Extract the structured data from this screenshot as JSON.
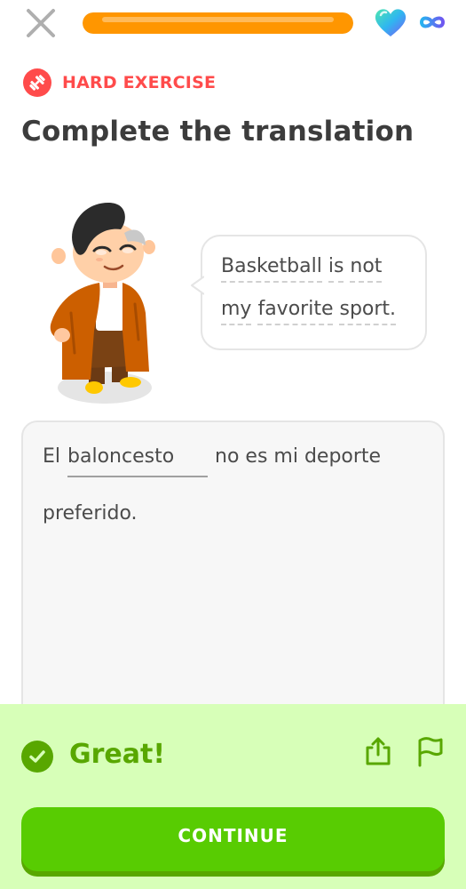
{
  "topbar": {
    "close_icon": "close-icon",
    "progress_fraction": 1.0,
    "heart_icon": "gem-heart-icon",
    "hearts_value": "∞"
  },
  "exercise": {
    "badge_icon": "dumbbell-icon",
    "badge_label": "HARD EXERCISE",
    "title": "Complete the translation"
  },
  "prompt": {
    "lines": [
      [
        "Basketball",
        "is",
        "not"
      ],
      [
        "my",
        "favorite",
        "sport."
      ]
    ]
  },
  "answer": {
    "before_blank": "El",
    "blank_value": "baloncesto",
    "after_blank": "no es mi deporte",
    "second_line": "preferido."
  },
  "result": {
    "title": "Great!",
    "continue_label": "CONTINUE"
  },
  "colors": {
    "progress": "#ff9600",
    "badge": "#ff4b4b",
    "success_bg": "#d7ffb8",
    "success_text": "#58a700",
    "button": "#58cc02"
  }
}
